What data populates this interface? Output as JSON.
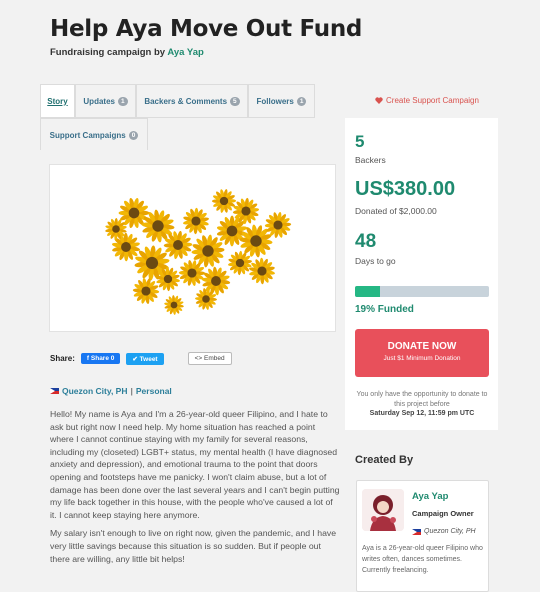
{
  "campaign": {
    "title": "Help Aya Move Out Fund",
    "subtitle_prefix": "Fundraising campaign by",
    "owner": "Aya Yap"
  },
  "tabs": [
    {
      "label": "Story",
      "count": null
    },
    {
      "label": "Updates",
      "count": "1"
    },
    {
      "label": "Backers & Comments",
      "count": "5"
    },
    {
      "label": "Followers",
      "count": "1"
    },
    {
      "label": "Support Campaigns",
      "count": "0"
    }
  ],
  "create_link": "Create Support Campaign",
  "share": {
    "label": "Share:",
    "facebook": "Share 0",
    "twitter": "Tweet",
    "embed": "Embed"
  },
  "location": {
    "city": "Quezon City, PH",
    "separator": "|",
    "category": "Personal"
  },
  "story": {
    "p1": "Hello! My name is Aya and I'm a 26-year-old queer Filipino, and I hate to ask but right now I need help. My home situation has reached a point where I cannot continue staying with my family for several reasons, including my (closeted) LGBT+ status, my mental health (I have diagnosed anxiety and depression), and emotional trauma to the point that doors opening and footsteps have me panicky. I won't claim abuse, but a lot of damage has been done over the last several years and I can't begin putting my life back together in this house, with the people who've caused a lot of it. I cannot keep staying here anymore.",
    "p2": "My salary isn't enough to live on right now, given the pandemic, and I have very little savings because this situation is so sudden. But if people out there are willing, any little bit helps!"
  },
  "stats": {
    "backers_count": "5",
    "backers_label": "Backers",
    "raised": "US$380.00",
    "goal_text": "Donated of $2,000.00",
    "days": "48",
    "days_label": "Days to go",
    "funded_text": "19% Funded",
    "funded_fraction": 0.19
  },
  "donate": {
    "label": "DONATE NOW",
    "sub": "Just $1 Minimum Donation"
  },
  "deadline": {
    "note": "You only have the opportunity to donate to this project before",
    "date": "Saturday Sep 12, 11:59 pm UTC"
  },
  "creator": {
    "heading": "Created By",
    "name": "Aya Yap",
    "role": "Campaign Owner",
    "location": "Quezon City, PH",
    "bio": "Aya is a 26-year-old queer Filipino who writes often, dances sometimes. Currently freelancing."
  },
  "colors": {
    "accent": "#1f8a6f",
    "donate": "#e8505b",
    "progress": "#25b784",
    "link_red": "#d9534f"
  },
  "icons": [
    "heart-icon",
    "facebook-icon",
    "twitter-icon",
    "embed-icon",
    "flag-ph-icon"
  ]
}
